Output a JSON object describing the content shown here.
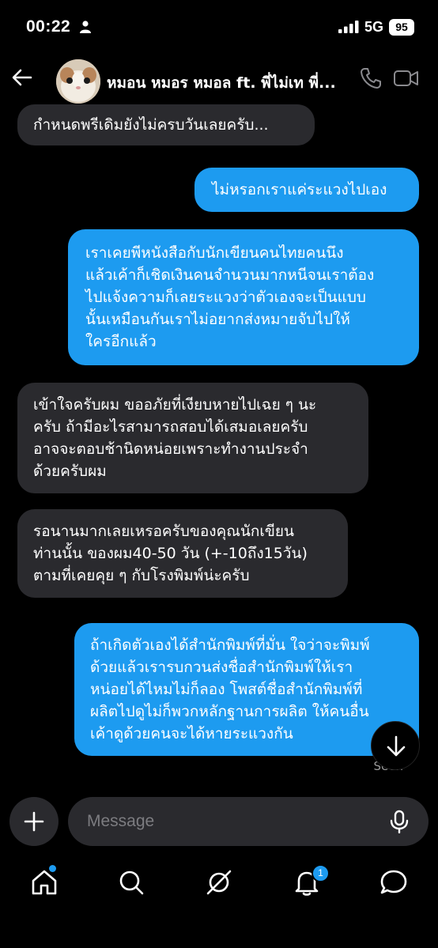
{
  "status_bar": {
    "time": "00:22",
    "network": "5G",
    "battery": "95"
  },
  "header": {
    "title": "หมอน หมอร หมอล ft. พี่ไม่เท พี่..."
  },
  "messages": [
    {
      "direction": "in",
      "text": "กำหนดพรีเดิมยังไม่ครบวันเลยครับ..."
    },
    {
      "direction": "out",
      "text": "ไม่หรอกเราแค่ระแวงไปเอง"
    },
    {
      "direction": "out",
      "lines": [
        "เราเคยพีหนังสือกับนักเขียนคนไทยคนนึง",
        "แล้วเค้าก็เชิดเงินคนจำนวนมากหนีจนเราต้อง",
        "ไปแจ้งความก็เลยระแวงว่าตัวเองจะเป็นแบบ",
        "นั้นเหมือนกันเราไม่อยากส่งหมายจับไปให้",
        "ใครอีกแล้ว"
      ]
    },
    {
      "direction": "in",
      "lines": [
        "เข้าใจครับผม ขออภัยที่เงียบหายไปเฉย ๆ นะ",
        "ครับ ถ้ามีอะไรสามารถสอบได้เสมอเลยครับ",
        "อาจจะตอบช้านิดหน่อยเพราะทำงานประจำ",
        "ด้วยครับผม"
      ]
    },
    {
      "direction": "in",
      "lines": [
        "รอนานมากเลยเหรอครับของคุณนักเขียน",
        "ท่านนั้น ของผม40-50 วัน (+-10ถึง15วัน)",
        "ตามที่เคยคุย ๆ กับโรงพิมพ์น่ะครับ"
      ]
    },
    {
      "direction": "out",
      "lines": [
        "ถ้าเกิดตัวเองได้สำนักพิมพ์ที่มั่น ใจว่าจะพิมพ์",
        "ด้วยแล้วเรารบกวนส่งชื่อสำนักพิมพ์ให้เรา",
        "หน่อยได้ไหมไม่ก็ลอง โพสต์ชื่อสำนักพิมพ์ที่",
        "ผลิตไปดูไม่ก็พวกหลักฐานการผลิต ให้คนอื่น",
        "เค้าดูด้วยคนจะได้หายระแวงกัน"
      ]
    }
  ],
  "seen_label": "Seen",
  "composer": {
    "placeholder": "Message"
  },
  "nav": {
    "notifications_count": "1",
    "icons": [
      "home-icon",
      "search-icon",
      "grok-icon",
      "bell-icon",
      "chat-icon"
    ]
  },
  "colors": {
    "accent": "#1d9bf0",
    "incoming_bubble": "#2a2a2e",
    "background": "#000000"
  }
}
